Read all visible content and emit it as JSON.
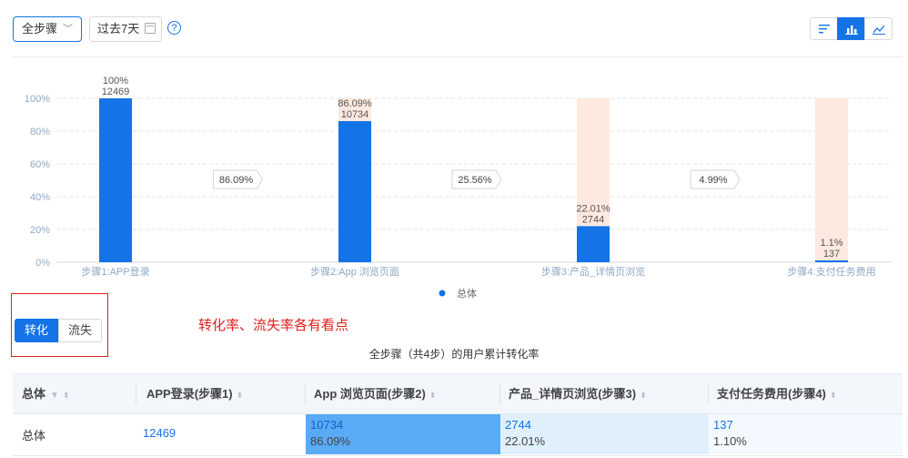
{
  "toolbar": {
    "step_select": "全步骤",
    "date_range": "过去7天",
    "help": "?"
  },
  "tabs": {
    "conversion": "转化",
    "churn": "流失"
  },
  "note": "转化率、流失率各有看点",
  "table_caption": "全步骤（共4步）的用户累计转化率",
  "colors": {
    "accent": "#1473e6",
    "bar": "#1473e6",
    "remaining": "#fde9df",
    "annotation": "#e0201e",
    "cell_strong": "#5aaaf5",
    "cell_light": "#dff0fc"
  },
  "chart_data": {
    "type": "bar",
    "categories": [
      "步骤1:APP登录",
      "步骤2:App 浏览页面",
      "步骤3:产品_详情页浏览",
      "步骤4:支付任务费用"
    ],
    "series": [
      {
        "name": "总体",
        "values": [
          100,
          86.09,
          22.01,
          1.1
        ],
        "counts": [
          "12469",
          "10734",
          "2744",
          "137"
        ],
        "labels": [
          "100%",
          "86.09%",
          "22.01%",
          "1.1%"
        ]
      }
    ],
    "step_rates": [
      "86.09%",
      "25.56%",
      "4.99%"
    ],
    "yticks": [
      "0%",
      "20%",
      "40%",
      "60%",
      "80%",
      "100%"
    ],
    "ylim": [
      0,
      100
    ],
    "grid": true,
    "legend": "bottom"
  },
  "table": {
    "headers": [
      "总体",
      "APP登录(步骤1)",
      "App 浏览页面(步骤2)",
      "产品_详情页浏览(步骤3)",
      "支付任务费用(步骤4)"
    ],
    "row": {
      "label": "总体",
      "cells": [
        {
          "value": "12469",
          "pct": ""
        },
        {
          "value": "10734",
          "pct": "86.09%"
        },
        {
          "value": "2744",
          "pct": "22.01%"
        },
        {
          "value": "137",
          "pct": "1.10%"
        }
      ]
    }
  }
}
